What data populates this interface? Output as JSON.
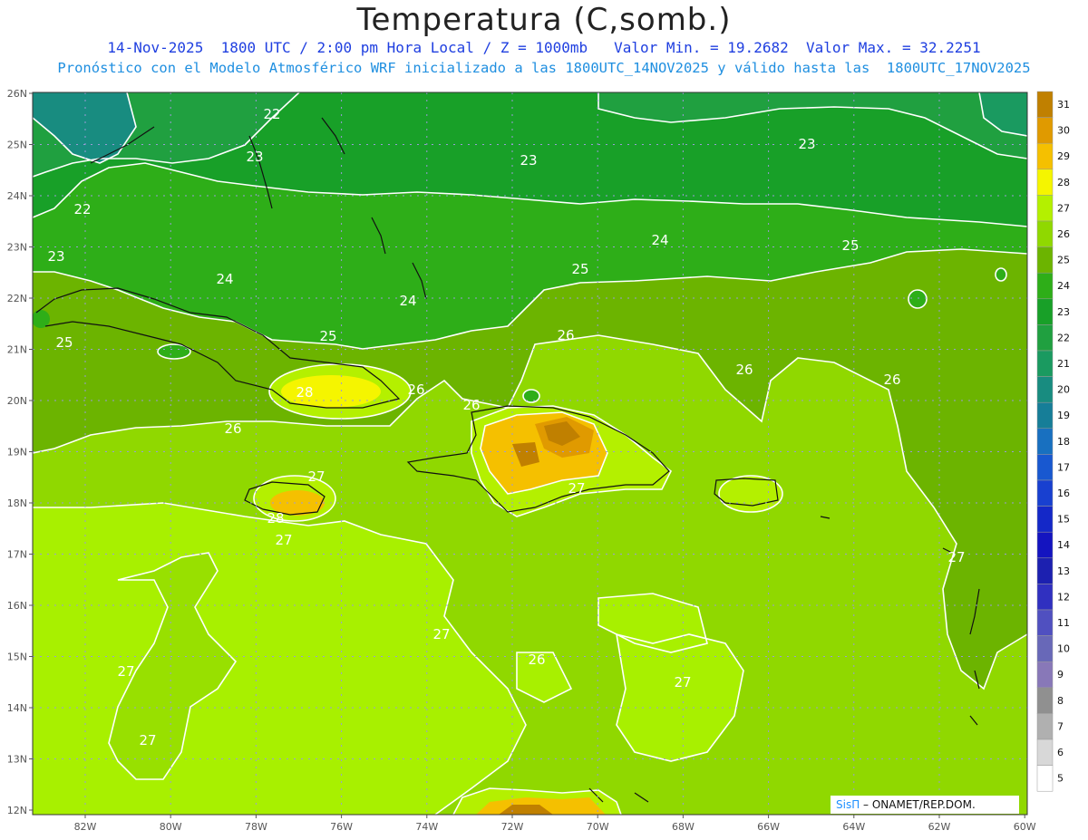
{
  "header": {
    "title": "Temperatura (C,somb.)",
    "line1": "14-Nov-2025  1800 UTC / 2:00 pm Hora Local / Z = 1000mb   Valor Min. = 19.2682  Valor Max. = 32.2251",
    "line2": "Pronóstico con el Modelo Atmosférico WRF inicializado a las 1800UTC_14NOV2025 y válido hasta las  1800UTC_17NOV2025"
  },
  "axes": {
    "lat_labels": [
      "26N",
      "25N",
      "24N",
      "23N",
      "22N",
      "21N",
      "20N",
      "19N",
      "18N",
      "17N",
      "16N",
      "15N",
      "14N",
      "13N",
      "12N"
    ],
    "lon_labels": [
      "82W",
      "80W",
      "78W",
      "76W",
      "74W",
      "72W",
      "70W",
      "68W",
      "66W",
      "64W",
      "62W",
      "60W"
    ]
  },
  "colorbar": {
    "levels": [
      "31",
      "30",
      "29",
      "28",
      "27",
      "26",
      "25",
      "24",
      "23",
      "22",
      "21",
      "20",
      "19",
      "18",
      "17",
      "16",
      "15",
      "14",
      "13",
      "12",
      "11",
      "10",
      "9",
      "8",
      "7",
      "6",
      "5"
    ],
    "colors": [
      "#c08000",
      "#e09a00",
      "#f5c000",
      "#f5f500",
      "#b4f000",
      "#90d800",
      "#6cb400",
      "#2eae18",
      "#18a028",
      "#20a040",
      "#1a9a60",
      "#188c80",
      "#167e98",
      "#1870c0",
      "#1858d0",
      "#1840d0",
      "#1428c8",
      "#1414c0",
      "#1c20b0",
      "#3030c0",
      "#5050c0",
      "#6868b8",
      "#8878b8",
      "#909090",
      "#b0b0b0",
      "#d8d8d8",
      "#ffffff"
    ]
  },
  "contour_labels": [
    {
      "text": "22"
    },
    {
      "text": "23"
    },
    {
      "text": "23"
    },
    {
      "text": "23"
    },
    {
      "text": "22"
    },
    {
      "text": "23"
    },
    {
      "text": "24"
    },
    {
      "text": "24"
    },
    {
      "text": "25"
    },
    {
      "text": "25"
    },
    {
      "text": "24"
    },
    {
      "text": "25"
    },
    {
      "text": "25"
    },
    {
      "text": "26"
    },
    {
      "text": "26"
    },
    {
      "text": "26"
    },
    {
      "text": "28"
    },
    {
      "text": "26"
    },
    {
      "text": "26"
    },
    {
      "text": "27"
    },
    {
      "text": "28"
    },
    {
      "text": "27"
    },
    {
      "text": "27"
    },
    {
      "text": "26"
    },
    {
      "text": "26"
    },
    {
      "text": "27"
    },
    {
      "text": "27"
    },
    {
      "text": "27"
    },
    {
      "text": "27"
    },
    {
      "text": "27"
    }
  ],
  "credit": {
    "logo": "SisΠ",
    "text": " – ONAMET/REP.DOM."
  }
}
